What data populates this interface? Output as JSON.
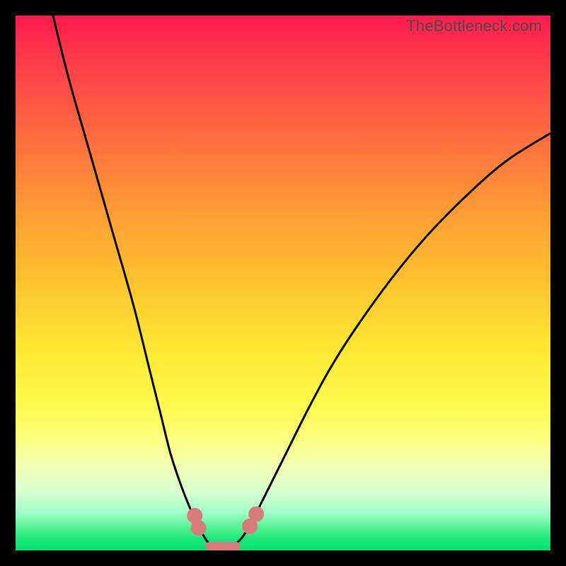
{
  "chart_data": {
    "type": "line",
    "title": "",
    "xlabel": "",
    "ylabel": "",
    "xlim": [
      0,
      100
    ],
    "ylim": [
      0,
      100
    ],
    "series": [
      {
        "name": "left-curve",
        "x": [
          7,
          10,
          14,
          18,
          22,
          25,
          27,
          29,
          31,
          33,
          34,
          35,
          36,
          37
        ],
        "values": [
          100,
          88,
          74,
          60,
          46,
          34,
          26,
          18,
          12,
          7,
          5,
          3,
          1.5,
          0.5
        ]
      },
      {
        "name": "right-curve",
        "x": [
          40,
          42,
          44,
          46,
          50,
          55,
          60,
          66,
          72,
          78,
          85,
          92,
          100
        ],
        "values": [
          0.5,
          2,
          5,
          9,
          17,
          27,
          36,
          45,
          53,
          60,
          67,
          73,
          78
        ]
      }
    ],
    "markers": {
      "left_cluster": [
        {
          "x": 33.5,
          "y": 6.5
        },
        {
          "x": 34.2,
          "y": 4.2
        }
      ],
      "right_cluster": [
        {
          "x": 43.8,
          "y": 4.5
        },
        {
          "x": 45.0,
          "y": 6.8
        }
      ],
      "valley_bar": {
        "x0": 35.5,
        "x1": 42.0,
        "y": 0.8,
        "height": 1.6
      }
    }
  },
  "watermark": "TheBottleneck.com",
  "colors": {
    "marker": "#d97b7b",
    "curve": "#000000"
  }
}
